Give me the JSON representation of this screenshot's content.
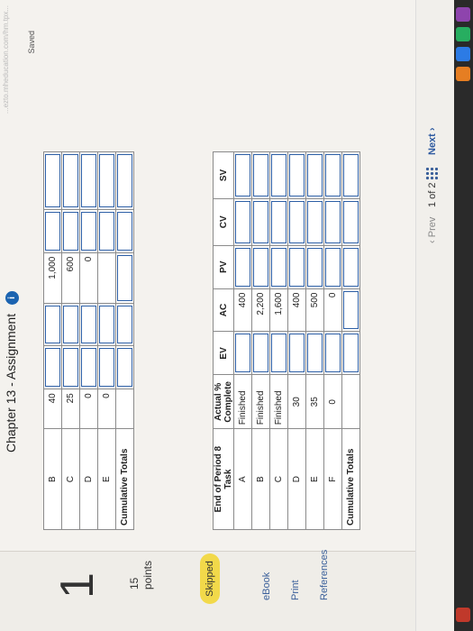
{
  "header": {
    "chapter_title": "Chapter 13 - Assignment",
    "saved_label": "Saved",
    "url_fragment": "...ezto.mheducation.com/hm.tpx..."
  },
  "sidebar": {
    "question_number": "1",
    "points_value": "15",
    "points_label": "points",
    "skipped_label": "Skipped",
    "links": [
      "eBook",
      "Print",
      "References"
    ]
  },
  "top_table": {
    "rows": [
      {
        "task": "B",
        "value": "40",
        "col2": "1,000"
      },
      {
        "task": "C",
        "value": "25",
        "col2": "600"
      },
      {
        "task": "D",
        "value": "0",
        "col2": "0"
      },
      {
        "task": "E",
        "value": "0",
        "col2": ""
      }
    ],
    "total_label": "Cumulative Totals"
  },
  "bottom_table": {
    "headers": {
      "period": "End of Period 8",
      "task": "Task",
      "actual": "Actual % Complete",
      "ev": "EV",
      "ac": "AC",
      "pv": "PV",
      "cv": "CV",
      "sv": "SV"
    },
    "rows": [
      {
        "task": "A",
        "actual": "Finished",
        "ac": "400"
      },
      {
        "task": "B",
        "actual": "Finished",
        "ac": "2,200"
      },
      {
        "task": "C",
        "actual": "Finished",
        "ac": "1,600"
      },
      {
        "task": "D",
        "actual": "30",
        "ac": "400"
      },
      {
        "task": "E",
        "actual": "35",
        "ac": "500"
      },
      {
        "task": "F",
        "actual": "0",
        "ac": "0"
      }
    ],
    "total_label": "Cumulative Totals"
  },
  "footer": {
    "prev_label": "Prev",
    "page_current": "1",
    "page_of": "of 2",
    "next_label": "Next"
  }
}
